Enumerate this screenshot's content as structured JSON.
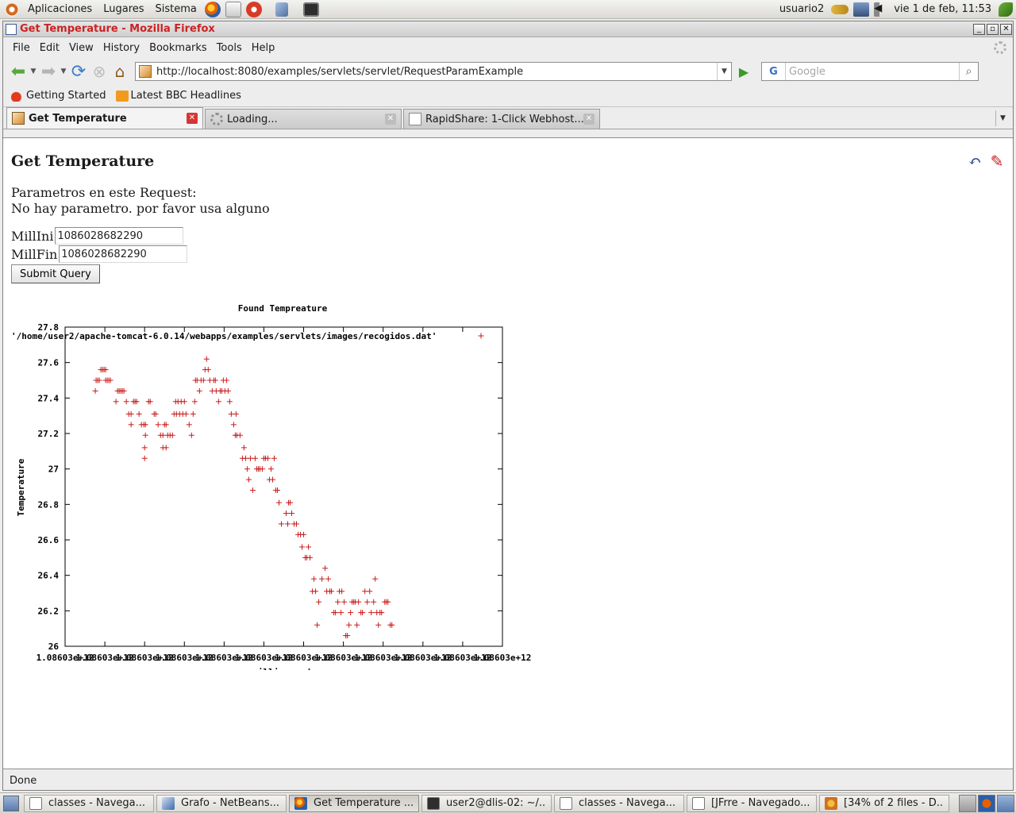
{
  "top_panel": {
    "menus": [
      "Aplicaciones",
      "Lugares",
      "Sistema"
    ],
    "user": "usuario2",
    "datetime": "vie  1 de feb, 11:53"
  },
  "window": {
    "title": "Get Temperature - Mozilla Firefox"
  },
  "menubar": [
    "File",
    "Edit",
    "View",
    "History",
    "Bookmarks",
    "Tools",
    "Help"
  ],
  "navbar": {
    "url": "http://localhost:8080/examples/servlets/servlet/RequestParamExample",
    "search_engine": "G",
    "search_placeholder": "Google"
  },
  "bookmarks": [
    "Getting Started",
    "Latest BBC Headlines"
  ],
  "tabs": [
    {
      "label": "Get Temperature",
      "active": true
    },
    {
      "label": "Loading...",
      "active": false
    },
    {
      "label": "RapidShare: 1-Click Webhost...",
      "active": false
    }
  ],
  "page": {
    "heading": "Get Temperature",
    "params_line1": "Parametros en este Request:",
    "params_line2": "No hay parametro. por favor usa alguno",
    "millini_label": "MillIni",
    "millini_value": "1086028682290",
    "millfin_label": "MillFin",
    "millfin_value": "1086028682290",
    "submit_label": "Submit Query"
  },
  "chart_data": {
    "type": "scatter",
    "title": "Found Tempreature",
    "xlabel": "milliseconds",
    "ylabel": "Temperature",
    "legend": "'/home/user2/apache-tomcat-6.0.14/webapps/examples/servlets/images/recogidos.dat'",
    "legend_placement": "top-right",
    "marker": "+",
    "color": "#c81c1c",
    "ylim": [
      26,
      27.8
    ],
    "y_ticks": [
      "26",
      "26.2",
      "26.4",
      "26.6",
      "26.8",
      "27",
      "27.2",
      "27.4",
      "27.6",
      "27.8"
    ],
    "x_ticks": [
      "1.08603e+12",
      "1.08603e+12",
      "1.08603e+12",
      "1.08603e+12",
      "1.08603e+12",
      "1.08603e+12",
      "1.08603e+12",
      "1.08603e+12",
      "1.08603e+12",
      "1.08603e+12",
      "1.08603e+12",
      "1.08603e+12"
    ],
    "x_index_range": [
      0,
      11
    ],
    "x_note": "x values below are positions in tick intervals (0 = first tick, 11 = last tick)",
    "points": [
      [
        0.76,
        27.44
      ],
      [
        0.78,
        27.5
      ],
      [
        0.82,
        27.5
      ],
      [
        0.86,
        27.5
      ],
      [
        0.9,
        27.56
      ],
      [
        0.94,
        27.56
      ],
      [
        0.98,
        27.56
      ],
      [
        1.02,
        27.56
      ],
      [
        1.06,
        27.5
      ],
      [
        1.1,
        27.5
      ],
      [
        1.14,
        27.5
      ],
      [
        1.02,
        27.5
      ],
      [
        1.28,
        27.38
      ],
      [
        1.32,
        27.44
      ],
      [
        1.36,
        27.44
      ],
      [
        1.4,
        27.44
      ],
      [
        1.44,
        27.44
      ],
      [
        1.48,
        27.44
      ],
      [
        1.54,
        27.38
      ],
      [
        1.6,
        27.31
      ],
      [
        1.66,
        27.31
      ],
      [
        1.66,
        27.25
      ],
      [
        1.72,
        27.38
      ],
      [
        1.76,
        27.38
      ],
      [
        1.8,
        27.38
      ],
      [
        1.86,
        27.31
      ],
      [
        1.92,
        27.25
      ],
      [
        1.98,
        27.25
      ],
      [
        2.02,
        27.19
      ],
      [
        2.0,
        27.12
      ],
      [
        2.0,
        27.06
      ],
      [
        2.02,
        27.25
      ],
      [
        2.1,
        27.38
      ],
      [
        2.14,
        27.38
      ],
      [
        2.24,
        27.31
      ],
      [
        2.28,
        27.31
      ],
      [
        2.34,
        27.25
      ],
      [
        2.4,
        27.19
      ],
      [
        2.46,
        27.19
      ],
      [
        2.46,
        27.12
      ],
      [
        2.5,
        27.25
      ],
      [
        2.54,
        27.25
      ],
      [
        2.54,
        27.12
      ],
      [
        2.58,
        27.19
      ],
      [
        2.64,
        27.19
      ],
      [
        2.7,
        27.19
      ],
      [
        2.74,
        27.31
      ],
      [
        2.8,
        27.31
      ],
      [
        2.78,
        27.38
      ],
      [
        2.84,
        27.38
      ],
      [
        2.88,
        27.31
      ],
      [
        2.92,
        27.38
      ],
      [
        2.96,
        27.31
      ],
      [
        3.0,
        27.38
      ],
      [
        3.04,
        27.31
      ],
      [
        3.12,
        27.25
      ],
      [
        3.18,
        27.19
      ],
      [
        3.22,
        27.31
      ],
      [
        3.26,
        27.38
      ],
      [
        3.28,
        27.5
      ],
      [
        3.32,
        27.5
      ],
      [
        3.38,
        27.44
      ],
      [
        3.42,
        27.5
      ],
      [
        3.48,
        27.5
      ],
      [
        3.52,
        27.56
      ],
      [
        3.56,
        27.62
      ],
      [
        3.6,
        27.56
      ],
      [
        3.64,
        27.5
      ],
      [
        3.7,
        27.44
      ],
      [
        3.74,
        27.5
      ],
      [
        3.78,
        27.5
      ],
      [
        3.8,
        27.44
      ],
      [
        3.86,
        27.38
      ],
      [
        3.9,
        27.44
      ],
      [
        3.94,
        27.44
      ],
      [
        3.98,
        27.5
      ],
      [
        4.02,
        27.44
      ],
      [
        4.06,
        27.5
      ],
      [
        4.1,
        27.44
      ],
      [
        4.14,
        27.38
      ],
      [
        4.18,
        27.31
      ],
      [
        4.24,
        27.25
      ],
      [
        4.28,
        27.19
      ],
      [
        4.32,
        27.19
      ],
      [
        4.3,
        27.31
      ],
      [
        4.4,
        27.19
      ],
      [
        4.46,
        27.06
      ],
      [
        4.5,
        27.12
      ],
      [
        4.54,
        27.06
      ],
      [
        4.58,
        27.0
      ],
      [
        4.62,
        26.94
      ],
      [
        4.66,
        27.06
      ],
      [
        4.72,
        26.88
      ],
      [
        4.78,
        27.06
      ],
      [
        4.82,
        27.0
      ],
      [
        4.86,
        27.0
      ],
      [
        4.9,
        27.0
      ],
      [
        4.96,
        27.0
      ],
      [
        5.0,
        27.06
      ],
      [
        5.04,
        27.06
      ],
      [
        5.1,
        27.06
      ],
      [
        5.14,
        26.94
      ],
      [
        5.18,
        27.0
      ],
      [
        5.22,
        26.94
      ],
      [
        5.26,
        27.06
      ],
      [
        5.3,
        26.88
      ],
      [
        5.34,
        26.88
      ],
      [
        5.38,
        26.81
      ],
      [
        5.44,
        26.69
      ],
      [
        5.56,
        26.75
      ],
      [
        5.6,
        26.69
      ],
      [
        5.62,
        26.81
      ],
      [
        5.66,
        26.81
      ],
      [
        5.7,
        26.75
      ],
      [
        5.76,
        26.69
      ],
      [
        5.82,
        26.69
      ],
      [
        5.86,
        26.63
      ],
      [
        5.92,
        26.63
      ],
      [
        5.96,
        26.56
      ],
      [
        6.0,
        26.63
      ],
      [
        6.04,
        26.5
      ],
      [
        6.08,
        26.5
      ],
      [
        6.12,
        26.56
      ],
      [
        6.16,
        26.5
      ],
      [
        6.22,
        26.31
      ],
      [
        6.26,
        26.38
      ],
      [
        6.3,
        26.31
      ],
      [
        6.34,
        26.12
      ],
      [
        6.38,
        26.25
      ],
      [
        6.46,
        26.38
      ],
      [
        6.54,
        26.44
      ],
      [
        6.58,
        26.31
      ],
      [
        6.62,
        26.38
      ],
      [
        6.66,
        26.31
      ],
      [
        6.7,
        26.31
      ],
      [
        6.76,
        26.19
      ],
      [
        6.8,
        26.19
      ],
      [
        6.86,
        26.25
      ],
      [
        6.9,
        26.31
      ],
      [
        6.94,
        26.19
      ],
      [
        6.96,
        26.31
      ],
      [
        7.02,
        26.25
      ],
      [
        7.06,
        26.06
      ],
      [
        7.1,
        26.06
      ],
      [
        7.14,
        26.12
      ],
      [
        7.18,
        26.19
      ],
      [
        7.22,
        26.25
      ],
      [
        7.26,
        26.25
      ],
      [
        7.3,
        26.25
      ],
      [
        7.34,
        26.12
      ],
      [
        7.38,
        26.25
      ],
      [
        7.44,
        26.19
      ],
      [
        7.48,
        26.19
      ],
      [
        7.54,
        26.31
      ],
      [
        7.6,
        26.25
      ],
      [
        7.66,
        26.31
      ],
      [
        7.7,
        26.19
      ],
      [
        7.76,
        26.25
      ],
      [
        7.8,
        26.38
      ],
      [
        7.84,
        26.19
      ],
      [
        7.88,
        26.12
      ],
      [
        7.92,
        26.19
      ],
      [
        7.96,
        26.19
      ],
      [
        8.04,
        26.25
      ],
      [
        8.08,
        26.25
      ],
      [
        8.12,
        26.25
      ],
      [
        8.18,
        26.12
      ],
      [
        8.22,
        26.12
      ]
    ]
  },
  "statusbar": "Done",
  "taskbar": [
    {
      "label": "classes - Navega...",
      "icon": "nautilus-icon",
      "active": false
    },
    {
      "label": "Grafo - NetBeans...",
      "icon": "netbeans-icon",
      "active": false
    },
    {
      "label": "Get Temperature ...",
      "icon": "firefox-icon",
      "active": true
    },
    {
      "label": "user2@dlis-02: ~/...",
      "icon": "terminal-icon",
      "active": false
    },
    {
      "label": "classes - Navega...",
      "icon": "nautilus-icon",
      "active": false
    },
    {
      "label": "[JFrre - Navegado...",
      "icon": "nautilus-icon",
      "active": false
    },
    {
      "label": "[34% of 2 files - D...",
      "icon": "download-icon",
      "active": false
    }
  ]
}
